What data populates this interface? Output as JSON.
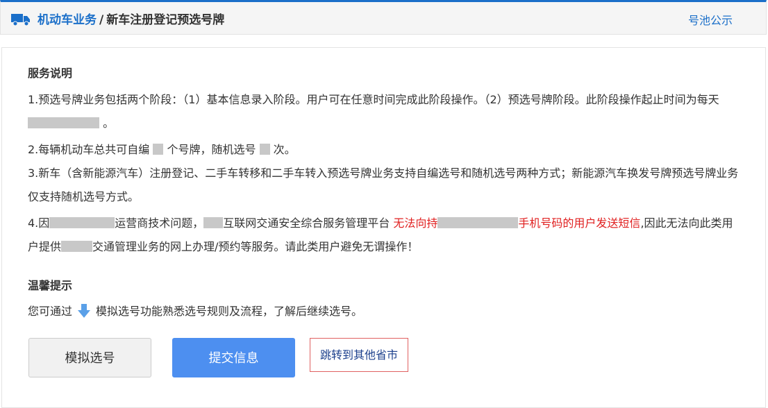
{
  "header": {
    "breadcrumb_section": "机动车业务",
    "breadcrumb_separator": "/",
    "breadcrumb_page": "新车注册登记预选号牌",
    "pool_link": "号池公示",
    "accent_color": "#1b6fc9"
  },
  "service": {
    "title": "服务说明",
    "p1a": "1.预选号牌业务包括两个阶段：（1）基本信息录入阶段。用户可在任意时间完成此阶段操作。（2）预选号牌阶段。此阶段操作起止时间为每天",
    "p1b": "。",
    "p2a": "2.每辆机动车总共可自编",
    "p2b": "个号牌，随机选号",
    "p2c": "次。",
    "p3": "3.新车（含新能源汽车）注册登记、二手车转移和二手车转入预选号牌业务支持自编选号和随机选号两种方式；新能源汽车换发号牌预选号牌业务仅支持随机选号方式。",
    "p4a": "4.因",
    "p4b": "运营商技术问题，",
    "p4c": "互联网交通安全综合服务管理平台",
    "p4_red_a": "无法向持",
    "p4_red_b": "手机号码的用户发送短信",
    "p4d": ",因此无法向此类用户提供",
    "p4e": "交通管理业务的网上办理/预约等服务。请此类用户避免无谓操作！",
    "warning_color": "#e02020"
  },
  "tips": {
    "title": "温馨提示",
    "text_before": "您可通过",
    "text_after": "模拟选号功能熟悉选号规则及流程，了解后继续选号。",
    "icon": "arrow-down-icon"
  },
  "actions": {
    "simulate": "模拟选号",
    "submit": "提交信息",
    "jump": "跳转到其他省市",
    "submit_color": "#4d8ff0"
  }
}
